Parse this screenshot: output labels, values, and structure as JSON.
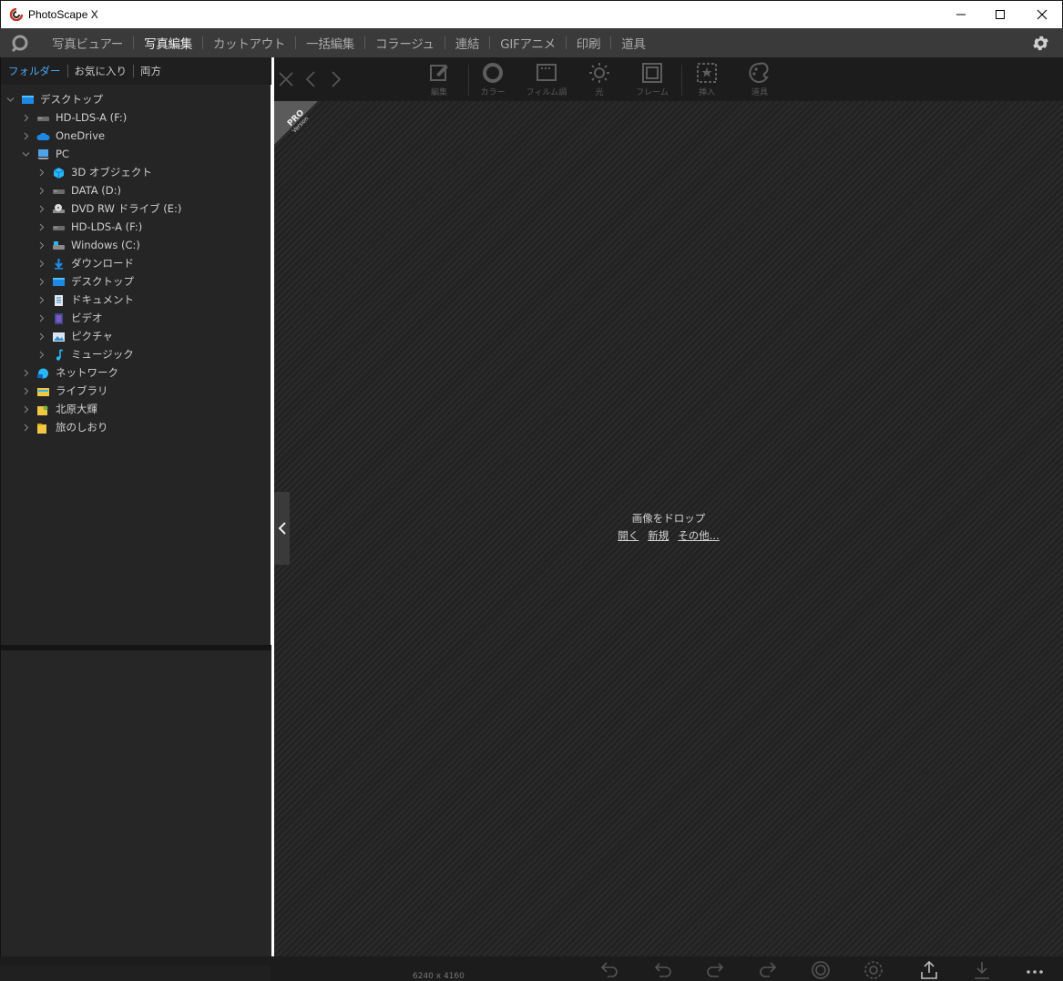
{
  "window": {
    "title": "PhotoScape X",
    "controls": {
      "minimize": "—",
      "maximize": "☐",
      "close": "✕"
    }
  },
  "menu": {
    "items": [
      "写真ビュアー",
      "写真編集",
      "カットアウト",
      "一括編集",
      "コラージュ",
      "連結",
      "GIFアニメ",
      "印刷",
      "道具"
    ],
    "active": "写真編集"
  },
  "left_panel": {
    "tabs": [
      "フォルダー",
      "お気に入り",
      "両方"
    ],
    "active_tab": "フォルダー",
    "tree": [
      {
        "label": "デスクトップ",
        "level": 0,
        "expanded": true,
        "icon": "desktop-icon"
      },
      {
        "label": "HD-LDS-A (F:)",
        "level": 1,
        "expanded": false,
        "icon": "drive-icon"
      },
      {
        "label": "OneDrive",
        "level": 1,
        "expanded": false,
        "icon": "cloud-icon"
      },
      {
        "label": "PC",
        "level": 1,
        "expanded": true,
        "icon": "pc-icon"
      },
      {
        "label": "3D オブジェクト",
        "level": 2,
        "expanded": false,
        "icon": "cube-icon"
      },
      {
        "label": "DATA (D:)",
        "level": 2,
        "expanded": false,
        "icon": "drive-icon"
      },
      {
        "label": "DVD RW ドライブ (E:)",
        "level": 2,
        "expanded": false,
        "icon": "dvd-icon"
      },
      {
        "label": "HD-LDS-A (F:)",
        "level": 2,
        "expanded": false,
        "icon": "drive-icon"
      },
      {
        "label": "Windows (C:)",
        "level": 2,
        "expanded": false,
        "icon": "windows-drive-icon"
      },
      {
        "label": "ダウンロード",
        "level": 2,
        "expanded": false,
        "icon": "download-icon"
      },
      {
        "label": "デスクトップ",
        "level": 2,
        "expanded": false,
        "icon": "desktop-icon"
      },
      {
        "label": "ドキュメント",
        "level": 2,
        "expanded": false,
        "icon": "document-icon"
      },
      {
        "label": "ビデオ",
        "level": 2,
        "expanded": false,
        "icon": "video-icon"
      },
      {
        "label": "ピクチャ",
        "level": 2,
        "expanded": false,
        "icon": "picture-icon"
      },
      {
        "label": "ミュージック",
        "level": 2,
        "expanded": false,
        "icon": "music-icon"
      },
      {
        "label": "ネットワーク",
        "level": 1,
        "expanded": false,
        "icon": "network-icon"
      },
      {
        "label": "ライブラリ",
        "level": 1,
        "expanded": false,
        "icon": "library-icon"
      },
      {
        "label": "北原大輝",
        "level": 1,
        "expanded": false,
        "icon": "user-folder-icon"
      },
      {
        "label": "旅のしおり",
        "level": 1,
        "expanded": false,
        "icon": "folder-icon"
      }
    ]
  },
  "toolbar": {
    "tools": [
      {
        "label": "編集",
        "icon": "edit-icon"
      },
      {
        "label": "カラー",
        "icon": "color-icon"
      },
      {
        "label": "フィルム調",
        "icon": "film-icon"
      },
      {
        "label": "光",
        "icon": "light-icon"
      },
      {
        "label": "フレーム",
        "icon": "frame-icon"
      },
      {
        "label": "挿入",
        "icon": "insert-icon"
      },
      {
        "label": "道具",
        "icon": "tools-icon"
      }
    ]
  },
  "canvas": {
    "pro_badge_line1": "PRO",
    "pro_badge_line2": "Version",
    "drop_title": "画像をドロップ",
    "links": [
      "開く",
      "新規",
      "その他..."
    ]
  },
  "bottom": {
    "dimensions": "6240 x 4160"
  },
  "colors": {
    "accent": "#4aa3f0",
    "menubar": "#3a3a3a",
    "panel": "#252525"
  }
}
